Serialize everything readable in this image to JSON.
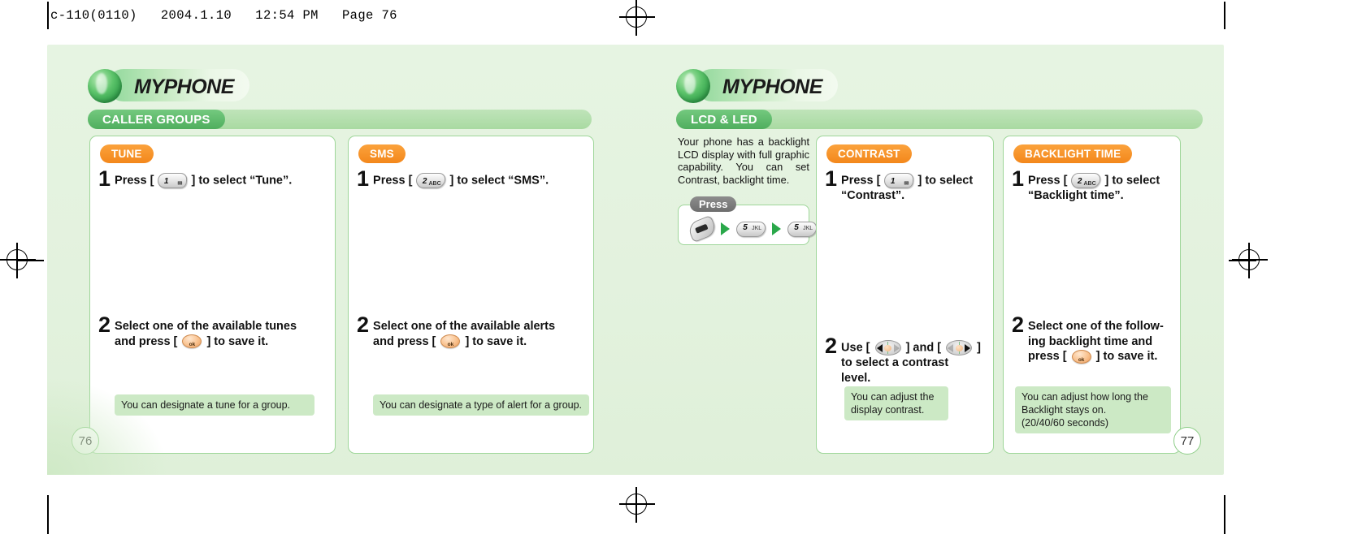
{
  "file_header": "c-110(0110)   2004.1.10   12:54 PM   Page 76",
  "left_page": {
    "brand": "MYPHONE",
    "section": "CALLER GROUPS",
    "page_number": "76",
    "panels": [
      {
        "badge": "TUNE",
        "steps": [
          {
            "num": "1",
            "lead": "Press [",
            "key": {
              "digit": "1",
              "sub": "✉"
            },
            "tail": "] to select “Tune”."
          },
          {
            "num": "2",
            "line1": "Select one of the available tunes",
            "line2_pre": "and press [",
            "line2_key": "ok",
            "line2_post": "] to save it."
          }
        ],
        "note": "You can designate a tune for a group."
      },
      {
        "badge": "SMS",
        "steps": [
          {
            "num": "1",
            "lead": "Press [",
            "key": {
              "digit": "2",
              "sub": "ABC"
            },
            "tail": "] to select “SMS”."
          },
          {
            "num": "2",
            "line1": "Select one of the available alerts",
            "line2_pre": "and press [",
            "line2_key": "ok",
            "line2_post": "] to save it."
          }
        ],
        "note": "You can designate a type of alert for a group."
      }
    ]
  },
  "right_page": {
    "brand": "MYPHONE",
    "section": "LCD & LED",
    "page_number": "77",
    "intro": "Your phone has a backlight LCD display with full graphic capability. You can set Contrast, backlight time.",
    "press_diagram": {
      "label": "Press",
      "keys": [
        {
          "type": "menu-key"
        },
        {
          "type": "arrow"
        },
        {
          "type": "digit-key",
          "digit": "5",
          "sub": "JKL"
        },
        {
          "type": "arrow"
        },
        {
          "type": "digit-key",
          "digit": "5",
          "sub": "JKL"
        }
      ]
    },
    "panels": [
      {
        "badge": "CONTRAST",
        "steps": [
          {
            "num": "1",
            "lead": "Press [",
            "key": {
              "digit": "1",
              "sub": "✉"
            },
            "tail": "] to select",
            "tail2": "“Contrast”."
          },
          {
            "num": "2",
            "line1_pre": "Use [",
            "line1_mid": "] and [",
            "line1_post": "]",
            "line2": "to select a contrast",
            "line3": "level."
          }
        ],
        "note_line1": "You can adjust the",
        "note_line2": "display contrast."
      },
      {
        "badge": "BACKLIGHT TIME",
        "steps": [
          {
            "num": "1",
            "lead": "Press [",
            "key": {
              "digit": "2",
              "sub": "ABC"
            },
            "tail": "] to select",
            "tail2": "“Backlight time”."
          },
          {
            "num": "2",
            "line1": "Select one of the follow-",
            "line2": "ing backlight time and",
            "line3_pre": "press [",
            "line3_key": "ok",
            "line3_post": "] to save it."
          }
        ],
        "note_line1": "You can adjust how long the",
        "note_line2": "Backlight stays on.",
        "note_line3": "(20/40/60 seconds)"
      }
    ]
  },
  "colors": {
    "page_bg": "#e4f2df",
    "green_accent": "#4fae5e",
    "orange_badge": "#f3871b",
    "note_bg": "#cce9c5",
    "panel_border": "#9ed699"
  }
}
